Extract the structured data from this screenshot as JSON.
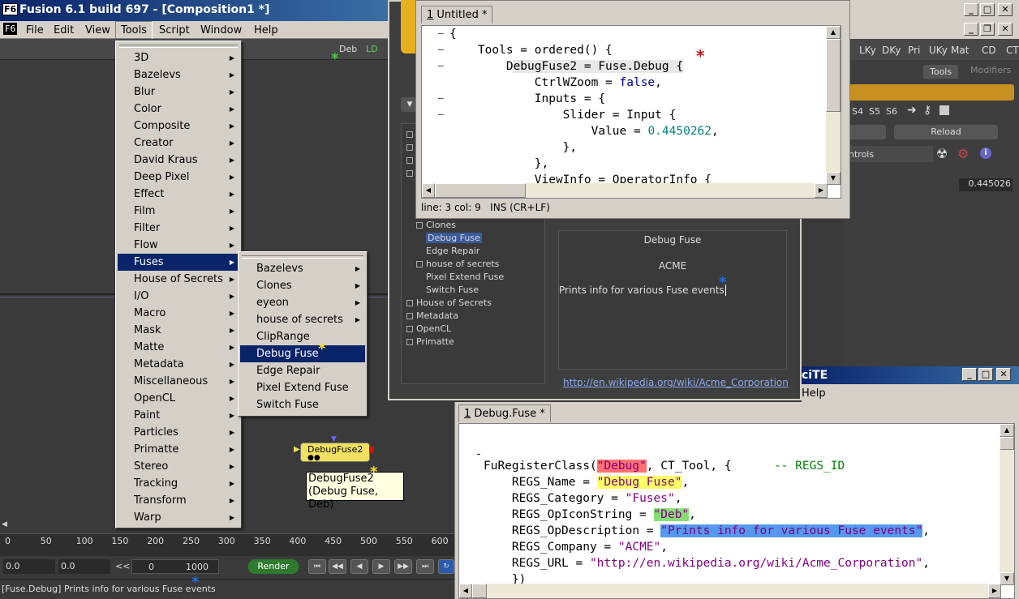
{
  "main": {
    "logo": "F6",
    "title": "Fusion 6.1 build 697 - [Composition1 *]",
    "menu": [
      "File",
      "Edit",
      "View",
      "Tools",
      "Script",
      "Window",
      "Help"
    ],
    "toolbar_labels": {
      "deb": "Deb",
      "ld": "LD"
    },
    "right_tool_labels": [
      "LKy",
      "DKy",
      "Pri",
      "UKy",
      "Mat",
      "CD",
      "CT"
    ],
    "tabs": {
      "tools": "Tools",
      "modifiers": "Modifiers"
    },
    "panel": {
      "s_labels": [
        "S4",
        "S5",
        "S6"
      ],
      "reload": "Reload",
      "controls": "ntrols",
      "slider_value": "0.445026"
    }
  },
  "tools_menu": {
    "items": [
      "3D",
      "Bazelevs",
      "Blur",
      "Color",
      "Composite",
      "Creator",
      "David Kraus",
      "Deep Pixel",
      "Effect",
      "Film",
      "Filter",
      "Flow",
      "Fuses",
      "House of Secrets",
      "I/O",
      "Macro",
      "Mask",
      "Matte",
      "Metadata",
      "Miscellaneous",
      "OpenCL",
      "Paint",
      "Particles",
      "Primatte",
      "Stereo",
      "Tracking",
      "Transform",
      "Warp"
    ],
    "selected": "Fuses"
  },
  "fuses_menu": {
    "items": [
      "Bazelevs",
      "Clones",
      "eyeon",
      "house of secrets",
      "ClipRange",
      "Debug Fuse",
      "Edge Repair",
      "Pixel Extend Fuse",
      "Switch Fuse"
    ],
    "selected": "Debug Fuse"
  },
  "flow": {
    "node_label": "DebugFuse2",
    "tooltip_line1": "DebugFuse2",
    "tooltip_line2": "(Debug Fuse, Deb)"
  },
  "timeline": {
    "ticks": [
      "0",
      "50",
      "100",
      "150",
      "200",
      "250",
      "300",
      "350",
      "400",
      "450",
      "500",
      "550",
      "600"
    ],
    "start": "0.0",
    "end": "0.0",
    "range_start": "0",
    "range_end": "1000",
    "render": "Render",
    "rewind": "<<",
    "status": "[Fuse.Debug] Prints info for various Fuse events"
  },
  "browser": {
    "tree_top": [
      "",
      "",
      "",
      ""
    ],
    "tree": [
      {
        "text": "Clones",
        "indent": 1,
        "box": true
      },
      {
        "text": "Debug Fuse",
        "indent": 2,
        "box": false,
        "sel": true
      },
      {
        "text": "Edge Repair",
        "indent": 2,
        "box": false
      },
      {
        "text": "house of secrets",
        "indent": 1,
        "box": true
      },
      {
        "text": "Pixel Extend Fuse",
        "indent": 2,
        "box": false
      },
      {
        "text": "Switch Fuse",
        "indent": 2,
        "box": false
      },
      {
        "text": "House of Secrets",
        "indent": 0,
        "box": true
      },
      {
        "text": "Metadata",
        "indent": 0,
        "box": true
      },
      {
        "text": "OpenCL",
        "indent": 0,
        "box": true
      },
      {
        "text": "Primatte",
        "indent": 0,
        "box": true
      }
    ],
    "info_name": "Debug Fuse",
    "info_company": "ACME",
    "info_desc": "Prints info for various Fuse events",
    "link": "http://en.wikipedia.org/wiki/Acme_Corporation"
  },
  "editor1": {
    "tab_num": "1",
    "tab_name": "Untitled *",
    "status": "line: 3 col: 9   INS (CR+LF)",
    "lines": [
      "{",
      "    Tools = ordered() {",
      "        DebugFuse2 = Fuse.Debug {",
      "            CtrlWZoom = false,",
      "            Inputs = {",
      "                Slider = Input {",
      "                    Value = 0.4450262,",
      "                },",
      "            },",
      "            ViewInfo = OperatorInfo {"
    ]
  },
  "editor2": {
    "title": "ciTE",
    "menu_help": "Help",
    "tab_num": "1",
    "tab_name": "Debug.Fuse *",
    "code": {
      "l1_a": "FuRegisterClass(",
      "l1_str": "\"Debug\"",
      "l1_b": ", CT_Tool, {      ",
      "l1_comment": "-- REGS_ID",
      "l2_a": "    REGS_Name = ",
      "l2_str": "\"Debug Fuse\"",
      "l2_b": ",",
      "l3_a": "    REGS_Category = ",
      "l3_str": "\"Fuses\"",
      "l3_b": ",",
      "l4_a": "    REGS_OpIconString = ",
      "l4_str": "\"Deb\"",
      "l4_b": ",",
      "l5_a": "    REGS_OpDescription = ",
      "l5_str": "\"Prints info for various Fuse events\"",
      "l5_b": ",",
      "l6_a": "    REGS_Company = ",
      "l6_str": "\"ACME\"",
      "l6_b": ",",
      "l7_a": "    REGS_URL = ",
      "l7_str": "\"http://en.wikipedia.org/wiki/Acme_Corporation\"",
      "l7_b": ",",
      "l8": "    })"
    }
  },
  "colors": {
    "accent": "#0a246a",
    "highlight_red": "#ff7070",
    "highlight_yellow": "#ffff66",
    "highlight_green": "#88dd77",
    "highlight_blue": "#5599ee",
    "string_purple": "#800080",
    "comment_green": "#008000",
    "number_teal": "#008080"
  }
}
